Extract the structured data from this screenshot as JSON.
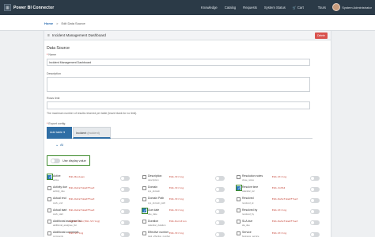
{
  "app": {
    "title": "Power BI Connector",
    "logo_icon": "grid-logo-icon"
  },
  "topnav": {
    "items": [
      "Knowledge",
      "Catalog",
      "Requests",
      "System Status",
      "Cart",
      "Tours"
    ],
    "cart_icon": "cart-icon"
  },
  "user": {
    "name": "System Administrator"
  },
  "breadcrumb": {
    "home": "Home",
    "separator": ">",
    "current": "Edit Data Source"
  },
  "card": {
    "title": "Incident Management Dashboard",
    "delete_label": "Delete",
    "section_title": "Data Source",
    "name_label": "Name",
    "name_value": "Incident Management Dashboard",
    "description_label": "Description",
    "description_value": "",
    "rows_limit_label": "Rows limit",
    "rows_limit_value": "",
    "rows_limit_hint": "The maximum number of results returned per table (leave blank for no limit).",
    "export_config_label": "Export config",
    "add_table_label": "Add table",
    "active_tab": {
      "name": "Incident",
      "sub": "(incident)"
    },
    "all_label": "All",
    "use_display_value_label": "Use display value"
  },
  "fields": [
    [
      {
        "name": "Active",
        "type": "Edm.Boolean",
        "column": "active",
        "checked": true
      },
      {
        "name": "Activity due",
        "type": "Edm.DateTimeOffset",
        "column": "activity_due",
        "checked": false
      },
      {
        "name": "Actual end",
        "type": "Edm.DateTimeOffset",
        "column": "work_end",
        "checked": false
      },
      {
        "name": "Actual start",
        "type": "Edm.DateTimeOffset",
        "column": "work_start",
        "checked": false
      },
      {
        "name": "Additional assignee list",
        "type": "Collection(Edm.String)",
        "column": "additional_assignee_list",
        "checked": false
      },
      {
        "name": "Additional comments",
        "type": "Edm.String",
        "column": "comments",
        "checked": false
      }
    ],
    [
      {
        "name": "Description",
        "type": "Edm.String",
        "column": "description",
        "checked": false
      },
      {
        "name": "Domain",
        "type": "Edm.String",
        "column": "sys_domain",
        "checked": false
      },
      {
        "name": "Domain Path",
        "type": "Edm.String",
        "column": "sys_domain_path",
        "checked": false
      },
      {
        "name": "Due date",
        "type": "Edm.String",
        "column": "due_date",
        "checked": true
      },
      {
        "name": "Duration",
        "type": "Edm.Duration",
        "column": "calendar_duration",
        "checked": false
      },
      {
        "name": "Effective number",
        "type": "Edm.String",
        "column": "task_effective_number",
        "checked": false
      }
    ],
    [
      {
        "name": "Resolution notes",
        "type": "Edm.String",
        "column": "close_notes",
        "checked": false
      },
      {
        "name": "Resolve time",
        "type": "Edm.Int64",
        "column": "calendar_stc",
        "checked": true
      },
      {
        "name": "Resolved",
        "type": "Edm.DateTimeOffset",
        "column": "resolved_at",
        "checked": false
      },
      {
        "name": "Resolved by",
        "type": "Edm.String",
        "column": "resolved_by",
        "checked": false
      },
      {
        "name": "SLA due",
        "type": "Edm.DateTimeOffset",
        "column": "sla_due",
        "checked": false
      },
      {
        "name": "Service",
        "type": "Edm.String",
        "column": "business_service",
        "checked": false
      }
    ]
  ],
  "colors": {
    "topbar": "#2b3a47",
    "accent": "#2f6ea5",
    "highlight": "#3c8a2a",
    "danger": "#d9534f"
  }
}
